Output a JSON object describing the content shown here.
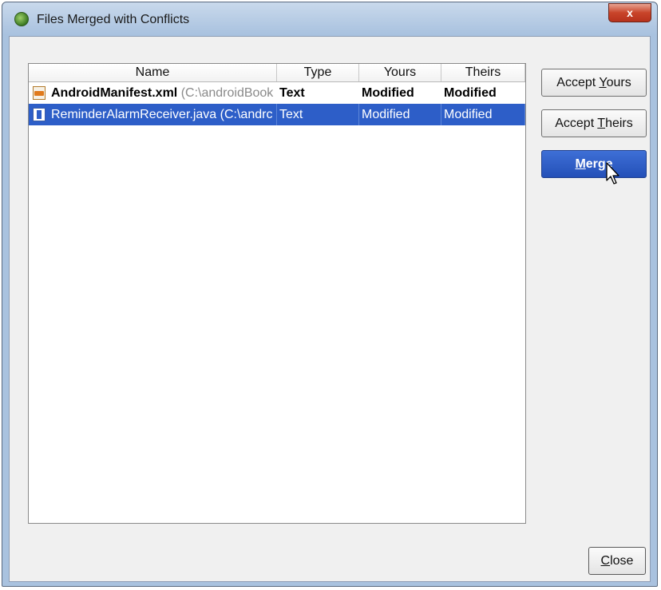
{
  "window": {
    "title": "Files Merged with Conflicts",
    "close_glyph": "x",
    "icon": "android-studio-icon"
  },
  "table": {
    "columns": [
      "Name",
      "Type",
      "Yours",
      "Theirs"
    ],
    "rows": [
      {
        "file": "AndroidManifest.xml",
        "path": "(C:\\androidBook",
        "type": "Text",
        "yours": "Modified",
        "theirs": "Modified",
        "icon": "xml-file-icon",
        "selected": false
      },
      {
        "file": "ReminderAlarmReceiver.java",
        "path": "(C:\\andrc",
        "type": "Text",
        "yours": "Modified",
        "theirs": "Modified",
        "icon": "java-file-icon",
        "selected": true
      }
    ]
  },
  "buttons": {
    "accept_yours_pre": "Accept ",
    "accept_yours_mnemonic": "Y",
    "accept_yours_post": "ours",
    "accept_theirs_pre": "Accept ",
    "accept_theirs_mnemonic": "T",
    "accept_theirs_post": "heirs",
    "merge_mnemonic": "M",
    "merge_post": "erge",
    "close_mnemonic": "C",
    "close_post": "lose"
  },
  "colors": {
    "selection": "#2d5ec8",
    "title_bar": "#a9c2df",
    "close_red": "#c9442a"
  }
}
